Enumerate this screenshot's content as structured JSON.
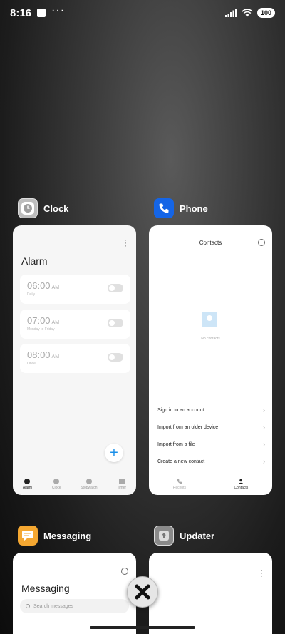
{
  "status_bar": {
    "time": "8:16",
    "dots": "···",
    "battery": "100"
  },
  "apps": {
    "clock": {
      "label": "Clock",
      "title": "Alarm",
      "alarms": [
        {
          "time": "06:00",
          "ampm": "AM",
          "sub": "Daily"
        },
        {
          "time": "07:00",
          "ampm": "AM",
          "sub": "Monday to Friday"
        },
        {
          "time": "08:00",
          "ampm": "AM",
          "sub": "Once"
        }
      ],
      "fab": "+",
      "tabs": [
        "Alarm",
        "Clock",
        "Stopwatch",
        "Timer"
      ]
    },
    "phone": {
      "label": "Phone",
      "title": "Contacts",
      "empty_text": "No contacts",
      "options": [
        "Sign in to an account",
        "Import from an older device",
        "Import from a file",
        "Create a new contact"
      ],
      "tabs": [
        "Recents",
        "Contacts"
      ]
    },
    "messaging": {
      "label": "Messaging",
      "title": "Messaging",
      "search_placeholder": "Search messages"
    },
    "updater": {
      "label": "Updater"
    }
  },
  "colors": {
    "clock_icon": "#bdbdbd",
    "phone_icon": "#1565e6",
    "messaging_icon": "#f4a731",
    "updater_icon": "#8a8a8a",
    "fab": "#1a8fe8"
  }
}
